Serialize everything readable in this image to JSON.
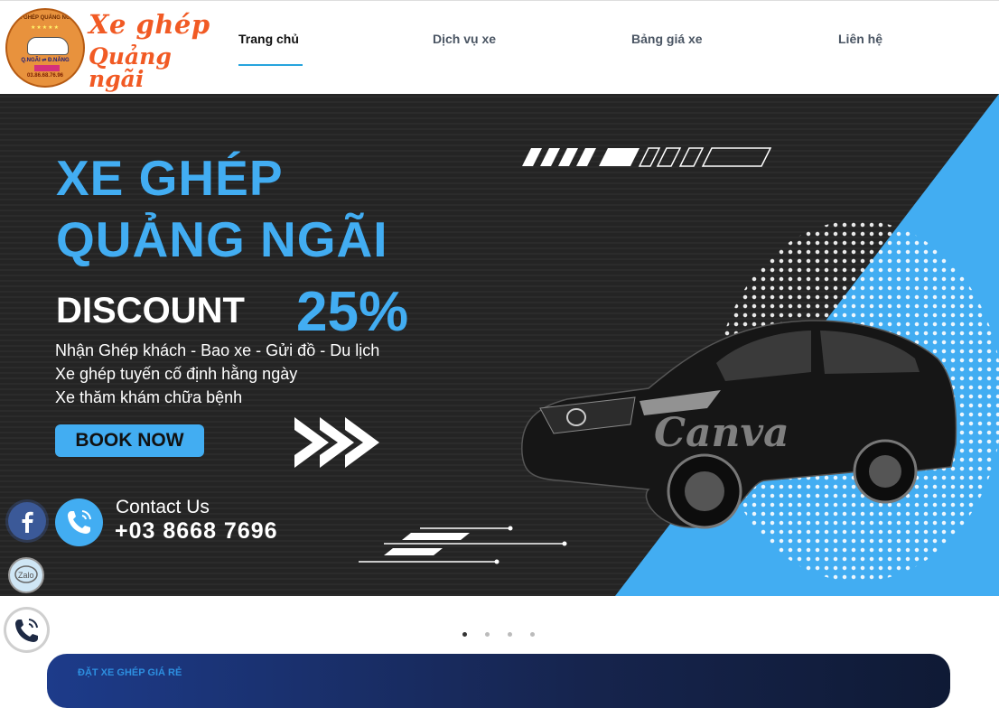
{
  "header": {
    "logo": {
      "badge_ring_text": "XE GHÉP QUẢNG NGÃI",
      "badge_stars": "★★★★★",
      "badge_route": "Q.NGÃI ⇌ Đ.NẴNG",
      "badge_phone": "03.86.68.76.96",
      "title_line1": "Xe ghép",
      "title_line2": "Quảng ngãi"
    },
    "nav": [
      {
        "label": "Trang chủ",
        "active": true
      },
      {
        "label": "Dịch vụ xe",
        "active": false
      },
      {
        "label": "Bảng giá xe",
        "active": false
      },
      {
        "label": "Liên hệ",
        "active": false
      }
    ]
  },
  "banner": {
    "title_line1": "XE GHÉP",
    "title_line2": "QUẢNG NGÃI",
    "discount_label": "DISCOUNT",
    "discount_value": "25%",
    "lines": [
      "Nhận Ghép khách - Bao xe - Gửi đồ - Du lịch",
      "Xe ghép tuyến cố định hằng ngày",
      "Xe thăm khám chữa bệnh"
    ],
    "cta": "BOOK NOW",
    "contact_label": "Contact Us",
    "contact_phone": "+03 8668 7696",
    "watermark": "Canva"
  },
  "floating": {
    "facebook_icon": "facebook-icon",
    "zalo_label": "Zalo",
    "phone_icon": "phone-icon"
  },
  "slider": {
    "count": 4,
    "active_index": 0
  },
  "booking_bar": {
    "label": "ĐẶT XE GHÉP GIÁ RẺ"
  },
  "colors": {
    "accent_blue": "#42adf2",
    "logo_orange": "#f15a24",
    "nav_underline": "#27a4dd",
    "banner_dark": "#242424"
  }
}
